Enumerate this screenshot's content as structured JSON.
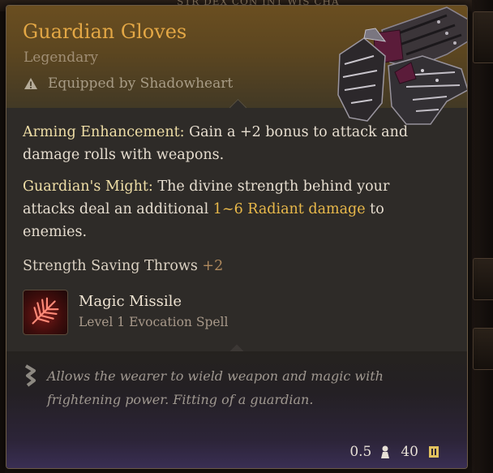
{
  "background": {
    "stats_header": "STR   DEX   CON   INT   WIS   CHA"
  },
  "tooltip": {
    "title": "Guardian Gloves",
    "rarity": "Legendary",
    "equipped_by": "Equipped by Shadowheart",
    "properties": [
      {
        "label": "Arming Enhancement:",
        "text": " Gain a +2 bonus to attack and damage rolls with weapons."
      },
      {
        "label": "Guardian's Might:",
        "text_before": " The divine strength behind your attacks deal an additional ",
        "highlight": "1~6 Radiant damage",
        "text_after": " to enemies."
      }
    ],
    "saving_throw": {
      "label": "Strength Saving Throws",
      "value": "+2"
    },
    "spell": {
      "name": "Magic Missile",
      "subtitle": "Level 1 Evocation Spell",
      "icon": "magic-missile-icon"
    },
    "flavor_text": "Allows the wearer to wield weapon and magic with frightening power. Fitting of a guardian.",
    "weight": "0.5",
    "value": "40"
  },
  "colors": {
    "title": "#e3a745",
    "highlight": "#e9b94a",
    "header_gold": "#6a4e20",
    "flavor_purple": "#3a2f55"
  }
}
